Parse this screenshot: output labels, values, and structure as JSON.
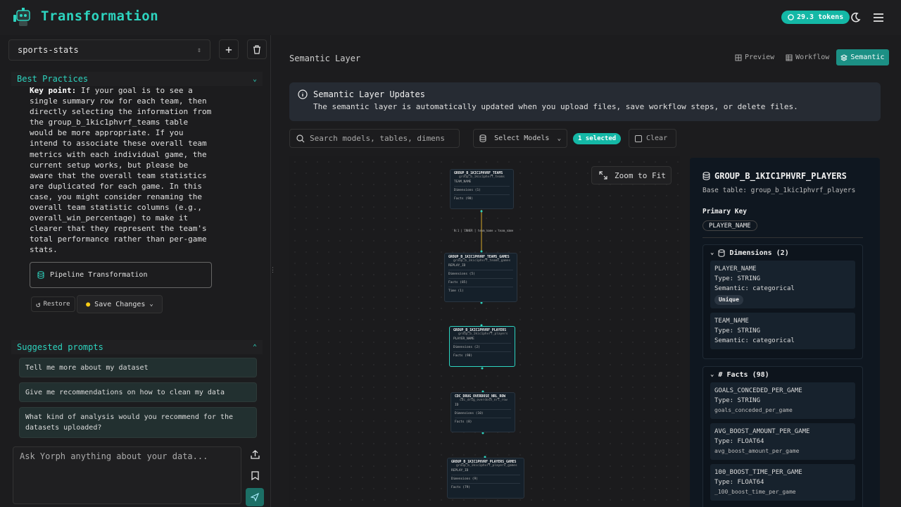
{
  "header": {
    "title": "Transformation",
    "tokens": "29.3 tokens"
  },
  "sidebar": {
    "dataset": "sports-stats",
    "best_practices": {
      "title": "Best Practices",
      "key_label": "Key point:",
      "text": " If your goal is to see a single summary row for each team, then directly selecting the information from the group_b_1kic1phvrf_teams table would be more appropriate. If you intend to associate these overall team metrics with each individual game, the current setup works, but please be aware that the overall team statistics are duplicated for each game. In this case, you might consider renaming the overall team statistic columns (e.g., overall_win_percentage) to make it clearer that they represent the team's total performance rather than per-game stats.",
      "pipeline_label": "Pipeline Transformation",
      "restore_label": "Restore",
      "save_label": "Save Changes"
    },
    "suggested": {
      "title": "Suggested prompts",
      "items": [
        "Tell me more about my dataset",
        "Give me recommendations on how to clean my data",
        "What kind of analysis would you recommend for the datasets uploaded?"
      ]
    },
    "chat_placeholder": "Ask Yorph anything about your data..."
  },
  "main": {
    "title": "Semantic Layer",
    "tabs": [
      "Preview",
      "Workflow",
      "Semantic"
    ],
    "banner": {
      "title": "Semantic Layer Updates",
      "text": "The semantic layer is automatically updated when you upload files, save workflow steps, or delete files."
    },
    "search_placeholder": "Search models, tables, dimens",
    "select_models": "Select Models",
    "selected_count": "1 selected",
    "clear_label": "Clear",
    "zoom_label": "Zoom to Fit",
    "edge_label": "N:1 | INNER | team_name = team_name",
    "nodes": [
      {
        "title": "GROUP_B_1KIC1PHVRF_TEAMS",
        "sub": "group_b_1kic1phvrf_teams",
        "key": "TEAM_NAME",
        "rows": [
          "Dimensions (1)",
          "Facts (98)"
        ]
      },
      {
        "title": "GROUP_B_1KIC1PHVRF_TEAMS_GAMES",
        "sub": "group_b_1kic1phvrf_teams_games",
        "key": "REPLAY_ID",
        "rows": [
          "Dimensions (5)",
          "Facts (85)",
          "Time (1)"
        ]
      },
      {
        "title": "GROUP_B_1KIC1PHVRF_PLAYERS",
        "sub": "group_b_1kic1phvrf_players",
        "key": "PLAYER_NAME",
        "rows": [
          "Dimensions (2)",
          "Facts (98)"
        ]
      },
      {
        "title": "CDC_DRUG_OVERDOSE_NRL_ROW",
        "sub": "cdc_drug_overdose_nrl_row",
        "key": "ID",
        "rows": [
          "Dimensions (10)",
          "Facts (8)"
        ]
      },
      {
        "title": "GROUP_B_1KIC1PHVRF_PLAYERS_GAMES",
        "sub": "group_b_1kic1phvrf_players_games",
        "key": "REPLAY_ID",
        "rows": [
          "Dimensions (9)",
          "Facts (79)"
        ]
      }
    ]
  },
  "detail": {
    "title": "GROUP_B_1KIC1PHVRF_PLAYERS",
    "base_table": "Base table: group_b_1kic1phvrf_players",
    "pk_label": "Primary Key",
    "pk_value": "PLAYER_NAME",
    "dimensions_title": "Dimensions (2)",
    "dimensions": [
      {
        "name": "PLAYER_NAME",
        "type": "Type: STRING",
        "semantic": "Semantic: categorical",
        "badge": "Unique"
      },
      {
        "name": "TEAM_NAME",
        "type": "Type: STRING",
        "semantic": "Semantic: categorical"
      }
    ],
    "facts_title": "Facts (98)",
    "facts": [
      {
        "name": "GOALS_CONCEDED_PER_GAME",
        "type": "Type: STRING",
        "col": "goals_conceded_per_game"
      },
      {
        "name": "AVG_BOOST_AMOUNT_PER_GAME",
        "type": "Type: FLOAT64",
        "col": "avg_boost_amount_per_game"
      },
      {
        "name": "100_BOOST_TIME_PER_GAME",
        "type": "Type: FLOAT64",
        "col": "_100_boost_time_per_game"
      }
    ]
  },
  "colors": {
    "accent": "#2dd4bf",
    "badge": "#14b8a6",
    "panel": "#0f1720"
  }
}
